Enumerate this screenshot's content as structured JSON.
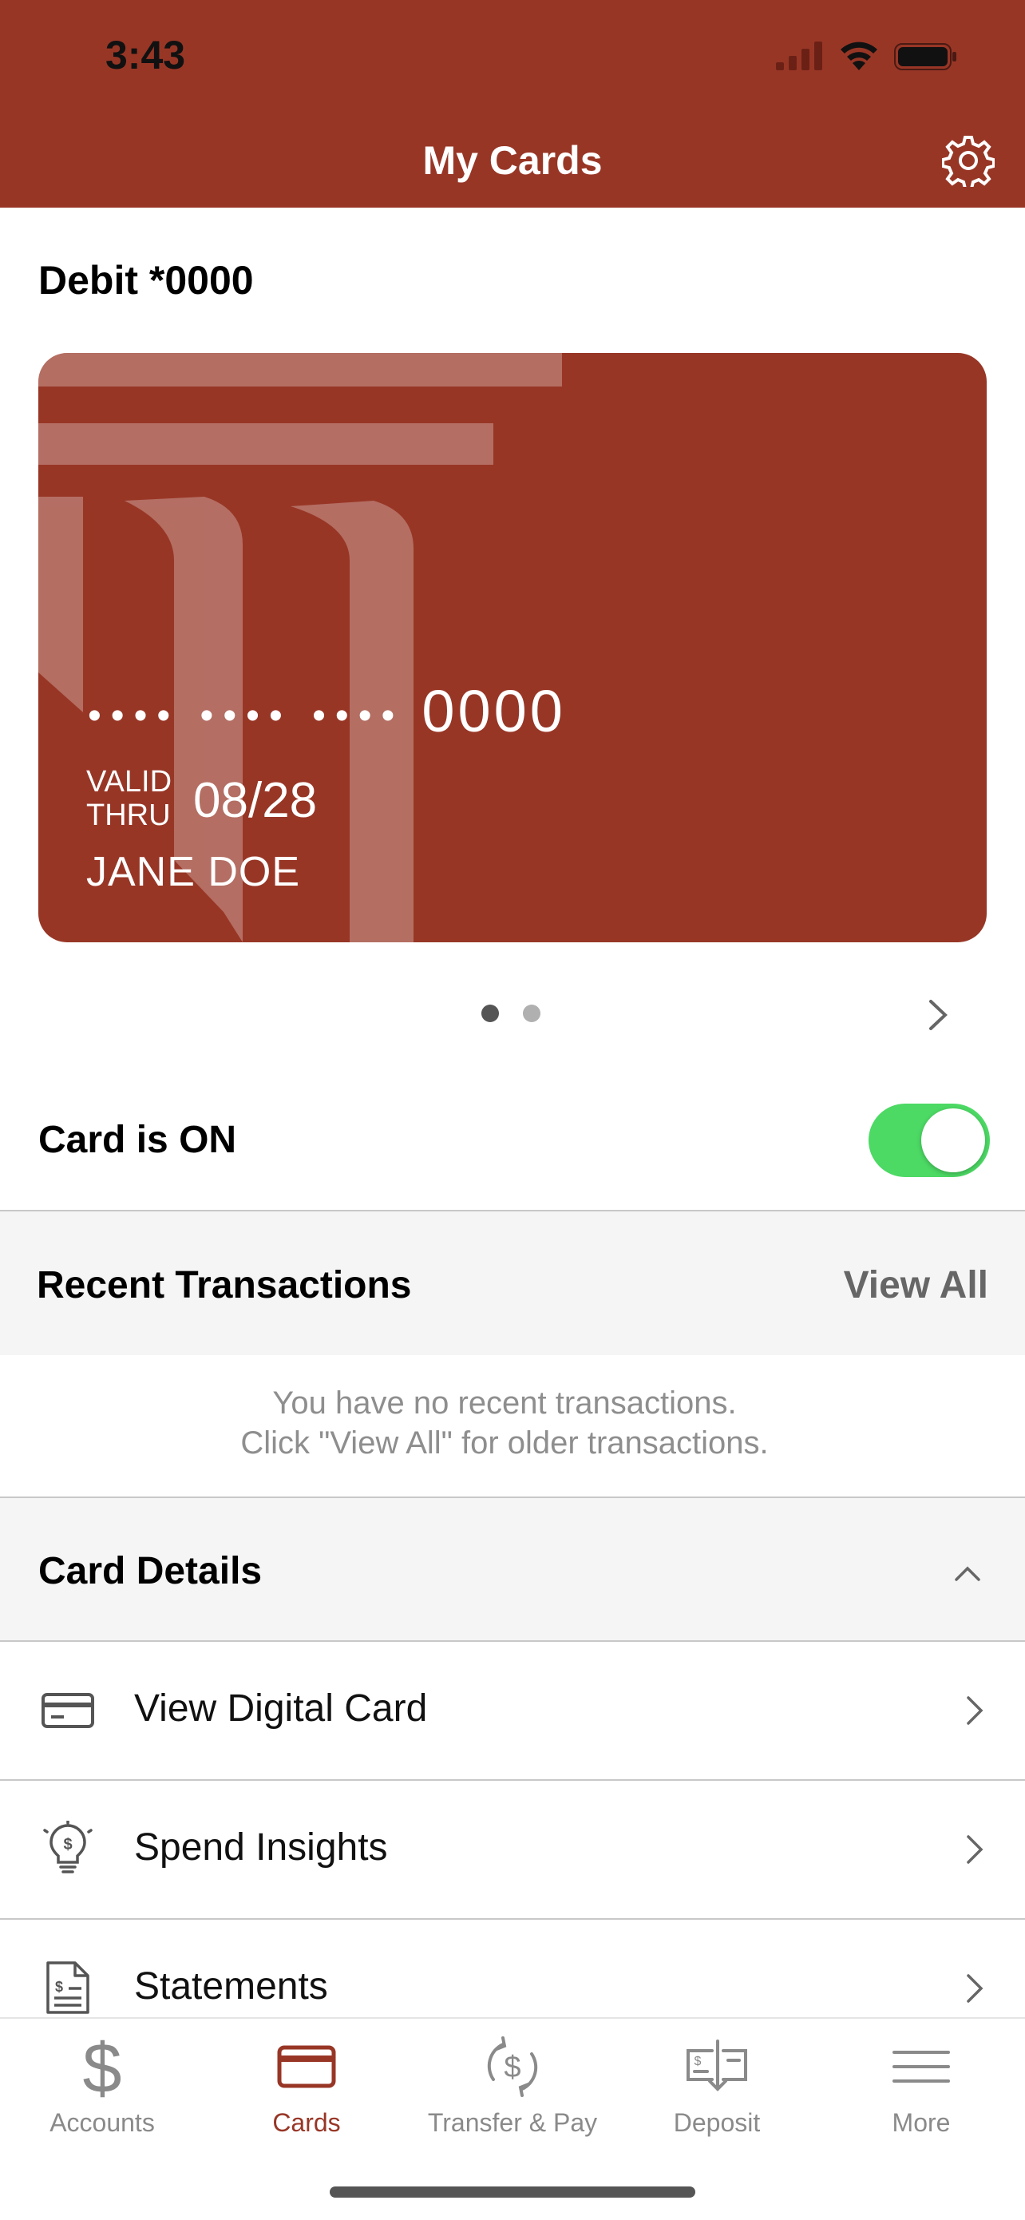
{
  "status_bar": {
    "time": "3:43"
  },
  "header": {
    "title": "My Cards",
    "settings_icon": "gear-icon",
    "background": "#983626"
  },
  "card": {
    "name": "Debit *0000",
    "number_masked": "•••• •••• ••••",
    "last4": "0000",
    "valid_label_line1": "VALID",
    "valid_label_line2": "THRU",
    "expiry": "08/28",
    "holder": "JANE DOE",
    "page_count": 2,
    "active_page": 1
  },
  "toggle": {
    "label": "Card is ON",
    "on": true,
    "color": "#4cd964"
  },
  "recent_transactions": {
    "title": "Recent Transactions",
    "view_all": "View All",
    "empty_line1": "You have no recent transactions.",
    "empty_line2": "Click \"View All\" for older transactions."
  },
  "card_details": {
    "title": "Card Details",
    "items": [
      {
        "label": "View Digital Card",
        "icon": "credit-card-icon"
      },
      {
        "label": "Spend Insights",
        "icon": "lightbulb-dollar-icon"
      },
      {
        "label": "Statements",
        "icon": "statement-document-icon"
      }
    ]
  },
  "tabs": [
    {
      "label": "Accounts",
      "icon": "dollar-icon",
      "active": false
    },
    {
      "label": "Cards",
      "icon": "card-icon",
      "active": true
    },
    {
      "label": "Transfer & Pay",
      "icon": "transfer-icon",
      "active": false
    },
    {
      "label": "Deposit",
      "icon": "check-deposit-icon",
      "active": false
    },
    {
      "label": "More",
      "icon": "menu-icon",
      "active": false
    }
  ],
  "colors": {
    "accent": "#983626",
    "toggle_on": "#4cd964",
    "muted": "#8a8a8a"
  }
}
